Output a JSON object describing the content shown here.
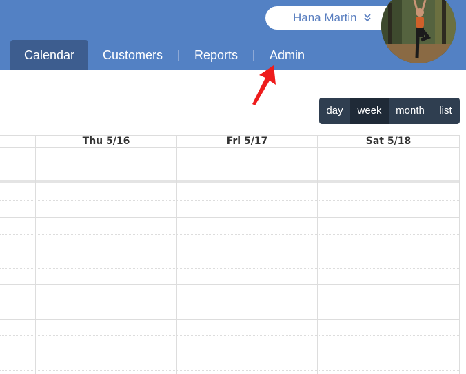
{
  "user": {
    "name": "Hana Martin"
  },
  "nav": {
    "tabs": [
      {
        "label": "Calendar",
        "active": true
      },
      {
        "label": "Customers",
        "active": false
      },
      {
        "label": "Reports",
        "active": false
      },
      {
        "label": "Admin",
        "active": false
      }
    ]
  },
  "views": {
    "options": [
      "day",
      "week",
      "month",
      "list"
    ],
    "selected": "week"
  },
  "calendar": {
    "columns": [
      "Thu 5/16",
      "Fri 5/17",
      "Sat 5/18"
    ]
  },
  "colors": {
    "header": "#5381c4",
    "active_tab": "#3d5d8f",
    "view_switch": "#2f3e50",
    "view_selected": "#1f2a37",
    "annotation_arrow": "#ee1c1c"
  },
  "icons": {
    "user_menu": "double-chevron-down-icon",
    "avatar": "user-avatar-photo"
  }
}
